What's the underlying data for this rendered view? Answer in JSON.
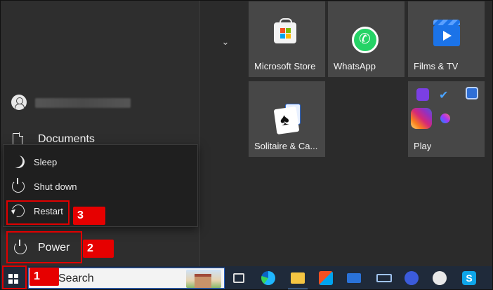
{
  "start_menu": {
    "documents_label": "Documents",
    "power_menu": {
      "items": [
        {
          "label": "Sleep",
          "icon": "moon-icon"
        },
        {
          "label": "Shut down",
          "icon": "power-icon"
        },
        {
          "label": "Restart",
          "icon": "restart-icon"
        }
      ]
    },
    "power_label": "Power"
  },
  "tiles": [
    {
      "label": "Microsoft Store",
      "icon": "store-icon"
    },
    {
      "label": "WhatsApp",
      "icon": "whatsapp-icon"
    },
    {
      "label": "Films & TV",
      "icon": "films-tv-icon"
    },
    {
      "label": "Solitaire & Ca...",
      "icon": "solitaire-icon"
    },
    {
      "label": "Play",
      "icon": "play-folder-icon"
    }
  ],
  "annotations": {
    "step1": "1",
    "step2": "2",
    "step3": "3",
    "color": "#e60000"
  },
  "taskbar": {
    "search_text": "Search",
    "icons": [
      "task-view-icon",
      "edge-icon",
      "file-explorer-icon",
      "store-icon",
      "mail-icon",
      "keyboard-icon",
      "video-icon",
      "paint-icon",
      "skype-icon"
    ]
  },
  "colors": {
    "accent": "#1b73e8",
    "tile_bg": "#474747",
    "taskbar_bg": "#1f2a3a"
  }
}
